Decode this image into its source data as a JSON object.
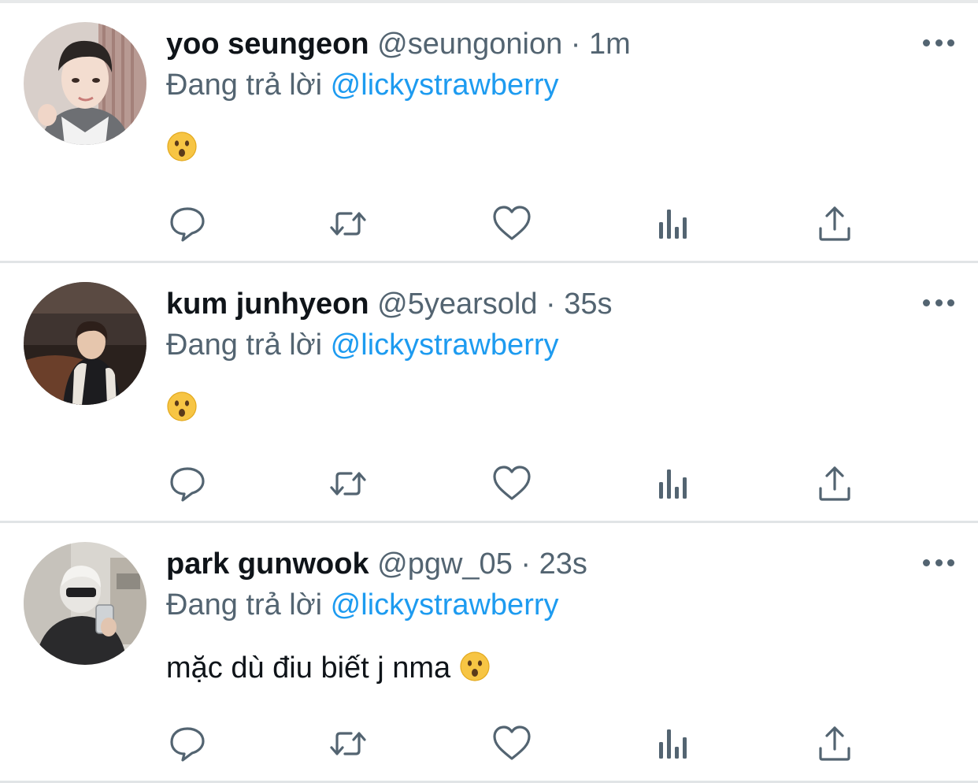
{
  "reply_prefix": "Đang trả lời",
  "colors": {
    "accent": "#1d9bf0",
    "secondary_text": "#536471",
    "primary_text": "#0f1419",
    "divider": "#e1e4e6"
  },
  "actions": [
    {
      "name": "reply-icon"
    },
    {
      "name": "retweet-icon"
    },
    {
      "name": "like-icon"
    },
    {
      "name": "analytics-icon"
    },
    {
      "name": "share-icon"
    }
  ],
  "tweets": [
    {
      "name": "yoo seungeon",
      "handle": "@seungonion",
      "sep": "·",
      "time": "1m",
      "reply_to": "@lickystrawberry",
      "text": "",
      "emoji": "hushed-face-emoji"
    },
    {
      "name": "kum junhyeon",
      "handle": "@5yearsold",
      "sep": "·",
      "time": "35s",
      "reply_to": "@lickystrawberry",
      "text": "",
      "emoji": "hushed-face-emoji"
    },
    {
      "name": "park gunwook",
      "handle": "@pgw_05",
      "sep": "·",
      "time": "23s",
      "reply_to": "@lickystrawberry",
      "text": "mặc dù điu biết j nma",
      "emoji": "hushed-face-emoji"
    }
  ]
}
